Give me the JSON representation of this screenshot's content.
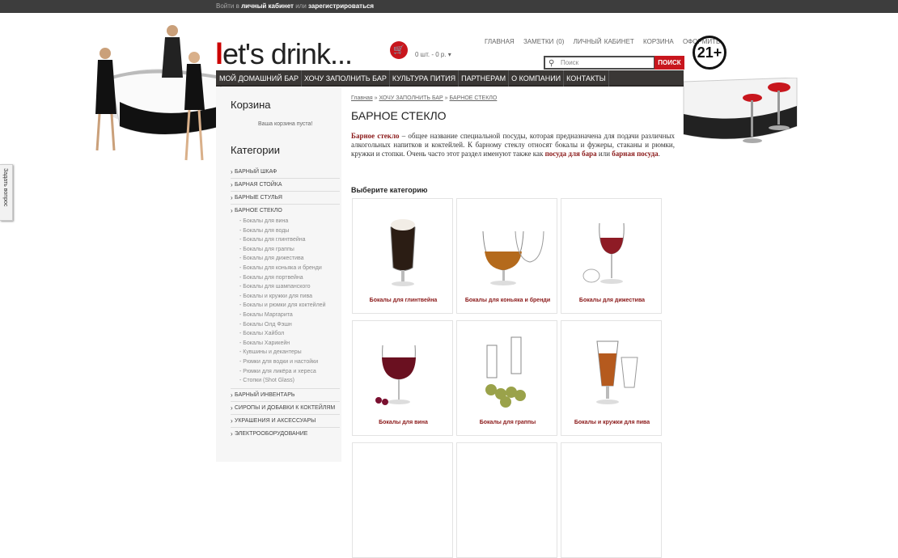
{
  "topbar": {
    "login_pre": "Войти в",
    "login_cabinet": "личный кабинет",
    "login_or": "или",
    "login_register": "зарегистрироваться"
  },
  "header": {
    "logo_l": "l",
    "logo_rest": "et's drink...",
    "cart_icon": "cart-icon",
    "cart_text": "0 шт. - 0 р.",
    "age_badge": "21+",
    "links": [
      "ГЛАВНАЯ",
      "ЗАМЕТКИ (0)",
      "ЛИЧНЫЙ КАБИНЕТ",
      "КОРЗИНА",
      "ОФОРМИТЬ"
    ],
    "search_placeholder": "Поиск",
    "search_button": "ПОИСК"
  },
  "nav": [
    "МОЙ ДОМАШНИЙ БАР",
    "ХОЧУ ЗАПОЛНИТЬ БАР",
    "КУЛЬТУРА ПИТИЯ",
    "ПАРТНЕРАМ",
    "О КОМПАНИИ",
    "КОНТАКТЫ"
  ],
  "sidebar": {
    "cart_title": "Корзина",
    "cart_empty": "Ваша корзина пуста!",
    "categories_title": "Категории",
    "categories_before": [
      "БАРНЫЙ ШКАФ",
      "БАРНАЯ СТОЙКА",
      "БАРНЫЕ СТУЛЬЯ",
      "БАРНОЕ СТЕКЛО"
    ],
    "subcategories": [
      "- Бокалы для вина",
      "- Бокалы для воды",
      "- Бокалы для глинтвейна",
      "- Бокалы для граппы",
      "- Бокалы для дижестива",
      "- Бокалы для коньяка и бренди",
      "- Бокалы для портвейна",
      "- Бокалы для шампанского",
      "- Бокалы и кружки для пива",
      "- Бокалы и рюмки для коктейлей",
      "- Бокалы Маргарита",
      "- Бокалы Олд Фэшн",
      "- Бокалы Хайбол",
      "- Бокалы Харикейн",
      "- Кувшины и декантеры",
      "- Рюмки для водки и настойки",
      "- Рюмки для ликёра и хереса",
      "- Стопки (Shot Glass)"
    ],
    "categories_after": [
      "БАРНЫЙ ИНВЕНТАРЬ",
      "СИРОПЫ И ДОБАВКИ К КОКТЕЙЛЯМ",
      "УКРАШЕНИЯ И АКСЕССУАРЫ",
      "ЭЛЕКТРООБОРУДОВАНИЕ"
    ]
  },
  "main": {
    "crumb_home": "Главная",
    "crumb_sep": " » ",
    "crumb_fill": "ХОЧУ ЗАПОЛНИТЬ БАР",
    "crumb_glass": "БАРНОЕ СТЕКЛО",
    "title": "БАРНОЕ СТЕКЛО",
    "intro_b1": "Барное стекло",
    "intro_t1": " – общее название специальной посуды, которая предназначена для подачи различных алкогольных напитков и коктейлей. К барному стеклу относят бокалы и фужеры, стаканы и рюмки, кружки и стопки. Очень часто этот раздел именуют также как ",
    "intro_b2": "посуда для бара",
    "intro_t2": " или ",
    "intro_b3": "барная посуда",
    "intro_t3": ".",
    "choose": "Выберите категорию"
  },
  "products": [
    {
      "label": "Бокалы для глинтвейна",
      "color": "#2b1d14"
    },
    {
      "label": "Бокалы для коньяка и бренди",
      "color": "#b46a1c"
    },
    {
      "label": "Бокалы для дижестива",
      "color": "#8e1b25"
    },
    {
      "label": "Бокалы для вина",
      "color": "#6a1020"
    },
    {
      "label": "Бокалы для граппы",
      "color": "#9aa24a"
    },
    {
      "label": "Бокалы и кружки для пива",
      "color": "#b55a1e"
    }
  ],
  "feedback": "Задать вопрос",
  "colors": {
    "accent": "#c8161d",
    "link_dark": "#8b1a1a",
    "nav_bg": "#3a3735"
  }
}
